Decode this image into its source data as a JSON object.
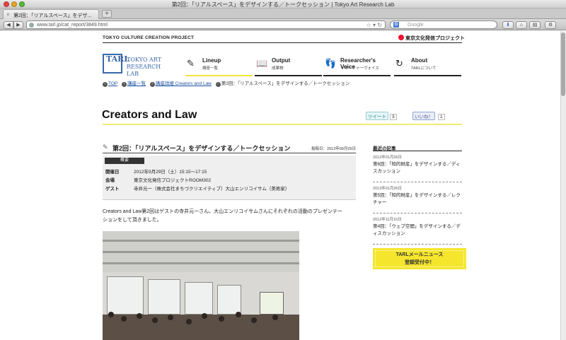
{
  "window": {
    "title": "第2回：「リアルスペース」をデザインする／トークセッション | Tokyo Art Research Lab"
  },
  "tab": {
    "label": "第2回：「リアルスペース」をデザ...",
    "new_tab": "+"
  },
  "toolbar": {
    "url": "www.tarl.jp/cat_report/3849.html",
    "search_placeholder": "Google",
    "search_engine_letter": "G"
  },
  "site": {
    "project": "TOKYO CULTURE CREATION PROJECT",
    "project_jp": "東京文化発信プロジェクト",
    "logo_mark": "TARL",
    "logo_line1": "TOKYO ART",
    "logo_line2": "RESEARCH LAB"
  },
  "nav": [
    {
      "en": "Lineup",
      "jp": "講座一覧",
      "icon": "pencil-icon"
    },
    {
      "en": "Output",
      "jp": "成果物",
      "icon": "book-icon"
    },
    {
      "en": "Researcher's Voice",
      "jp": "リサーチャーヴォイス",
      "icon": "footprints-icon"
    },
    {
      "en": "About",
      "jp": "TARLについて",
      "icon": "circle-arrow-icon"
    }
  ],
  "breadcrumb": {
    "top": "TOP",
    "list": "講座一覧",
    "detail": "講座詳細 Creators and Law",
    "current": "第2回：「リアルスペース」をデザインする／トークセッション"
  },
  "page": {
    "title": "Creators and Law",
    "tweet_label": "ツイート",
    "tweet_count": "3",
    "like_label": "いいね！",
    "like_count": "1"
  },
  "article": {
    "title": "第2回：「リアルスペース」をデザインする／トークセッション",
    "posted": "投稿日：2012年09月29日",
    "summary_tag": "概要",
    "rows": [
      {
        "label": "開催日",
        "value": "2012年9月29日（土）15:15〜17:15"
      },
      {
        "label": "会場",
        "value": "東京文化発信プロジェクトROOM302"
      },
      {
        "label": "ゲスト",
        "value": "寺井元一（株式会社まちづクリエイティブ）大山エンリコイサム（美術家）"
      }
    ],
    "lead_line1": "Creators and Law第2回はゲストの寺井元一さん、大山エンリコイサムさんにそれぞれの活動のプレゼンテー",
    "lead_line2": "ションをして頂きました。"
  },
  "sidebar": {
    "heading": "最近の記事",
    "items": [
      {
        "date": "2013年01月26日",
        "title": "第6回：「知的財産」をデザインする／ディスカッション"
      },
      {
        "date": "2013年01月26日",
        "title": "第5回：「知的財産」をデザインする／レクチャー"
      },
      {
        "date": "2012年11月10日",
        "title": "第4回：「ウェブ空間」をデザインする／ディスカッション"
      }
    ],
    "mail_line1": "TARLメールニュース",
    "mail_line2": "登録受付中！"
  },
  "colors": {
    "accent_yellow": "#f5e62d",
    "logo_blue": "#3968a8",
    "link_blue": "#1b4ea0"
  }
}
